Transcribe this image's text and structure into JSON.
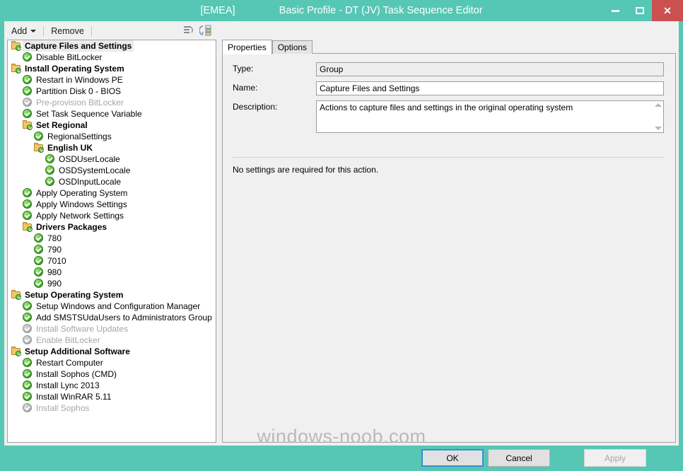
{
  "window": {
    "title_prefix": "[EMEA]",
    "title": "Basic Profile - DT (JV) Task Sequence Editor",
    "minimize_label": "Minimize",
    "maximize_label": "Maximize",
    "close_label": "Close",
    "close_glyph": "✕",
    "accent_color": "#55c7b4",
    "close_color": "#cb5050"
  },
  "toolbar": {
    "add_label": "Add",
    "remove_label": "Remove",
    "icon_rerun": "rerun-icon",
    "icon_properties": "step-properties-icon"
  },
  "tree": {
    "items": [
      {
        "label": "Capture Files and Settings",
        "indent": 0,
        "icon": "folder-check-icon",
        "type": "group",
        "state": "enabled",
        "selected": true
      },
      {
        "label": "Disable BitLocker",
        "indent": 1,
        "icon": "green-check-icon",
        "type": "step",
        "state": "enabled",
        "selected": false
      },
      {
        "label": "Install Operating System",
        "indent": 0,
        "icon": "folder-check-icon",
        "type": "group",
        "state": "enabled",
        "selected": false
      },
      {
        "label": "Restart in Windows PE",
        "indent": 1,
        "icon": "green-check-icon",
        "type": "step",
        "state": "enabled",
        "selected": false
      },
      {
        "label": "Partition Disk 0 - BIOS",
        "indent": 1,
        "icon": "green-check-icon",
        "type": "step",
        "state": "enabled",
        "selected": false
      },
      {
        "label": "Pre-provision BitLocker",
        "indent": 1,
        "icon": "grey-check-icon",
        "type": "step",
        "state": "disabled",
        "selected": false
      },
      {
        "label": "Set Task Sequence Variable",
        "indent": 1,
        "icon": "green-check-icon",
        "type": "step",
        "state": "enabled",
        "selected": false
      },
      {
        "label": "Set Regional",
        "indent": 1,
        "icon": "folder-check-icon",
        "type": "group",
        "state": "enabled",
        "selected": false
      },
      {
        "label": "RegionalSettings",
        "indent": 2,
        "icon": "green-check-icon",
        "type": "step",
        "state": "enabled",
        "selected": false
      },
      {
        "label": "English UK",
        "indent": 2,
        "icon": "folder-check-icon",
        "type": "group",
        "state": "enabled",
        "selected": false
      },
      {
        "label": "OSDUserLocale",
        "indent": 3,
        "icon": "green-check-icon",
        "type": "step",
        "state": "enabled",
        "selected": false
      },
      {
        "label": "OSDSystemLocale",
        "indent": 3,
        "icon": "green-check-icon",
        "type": "step",
        "state": "enabled",
        "selected": false
      },
      {
        "label": "OSDInputLocale",
        "indent": 3,
        "icon": "green-check-icon",
        "type": "step",
        "state": "enabled",
        "selected": false
      },
      {
        "label": "Apply Operating System",
        "indent": 1,
        "icon": "green-check-icon",
        "type": "step",
        "state": "enabled",
        "selected": false
      },
      {
        "label": "Apply Windows Settings",
        "indent": 1,
        "icon": "green-check-icon",
        "type": "step",
        "state": "enabled",
        "selected": false
      },
      {
        "label": "Apply Network Settings",
        "indent": 1,
        "icon": "green-check-icon",
        "type": "step",
        "state": "enabled",
        "selected": false
      },
      {
        "label": "Drivers Packages",
        "indent": 1,
        "icon": "folder-check-icon",
        "type": "group",
        "state": "enabled",
        "selected": false
      },
      {
        "label": "780",
        "indent": 2,
        "icon": "green-check-icon",
        "type": "step",
        "state": "enabled",
        "selected": false
      },
      {
        "label": "790",
        "indent": 2,
        "icon": "green-check-icon",
        "type": "step",
        "state": "enabled",
        "selected": false
      },
      {
        "label": "7010",
        "indent": 2,
        "icon": "green-check-icon",
        "type": "step",
        "state": "enabled",
        "selected": false
      },
      {
        "label": "980",
        "indent": 2,
        "icon": "green-check-icon",
        "type": "step",
        "state": "enabled",
        "selected": false
      },
      {
        "label": "990",
        "indent": 2,
        "icon": "green-check-icon",
        "type": "step",
        "state": "enabled",
        "selected": false
      },
      {
        "label": "Setup Operating System",
        "indent": 0,
        "icon": "folder-check-icon",
        "type": "group",
        "state": "enabled",
        "selected": false
      },
      {
        "label": "Setup Windows and Configuration Manager",
        "indent": 1,
        "icon": "green-check-icon",
        "type": "step",
        "state": "enabled",
        "selected": false
      },
      {
        "label": "Add SMSTSUdaUsers to Administrators Group",
        "indent": 1,
        "icon": "green-check-icon",
        "type": "step",
        "state": "enabled",
        "selected": false
      },
      {
        "label": "Install Software Updates",
        "indent": 1,
        "icon": "grey-check-icon",
        "type": "step",
        "state": "disabled",
        "selected": false
      },
      {
        "label": "Enable BitLocker",
        "indent": 1,
        "icon": "grey-check-icon",
        "type": "step",
        "state": "disabled",
        "selected": false
      },
      {
        "label": "Setup Additional Software",
        "indent": 0,
        "icon": "folder-check-icon",
        "type": "group",
        "state": "enabled",
        "selected": false
      },
      {
        "label": "Restart Computer",
        "indent": 1,
        "icon": "green-check-icon",
        "type": "step",
        "state": "enabled",
        "selected": false
      },
      {
        "label": "Install Sophos (CMD)",
        "indent": 1,
        "icon": "green-check-icon",
        "type": "step",
        "state": "enabled",
        "selected": false
      },
      {
        "label": "Install Lync 2013",
        "indent": 1,
        "icon": "green-check-icon",
        "type": "step",
        "state": "enabled",
        "selected": false
      },
      {
        "label": "Install WinRAR 5.11",
        "indent": 1,
        "icon": "green-check-icon",
        "type": "step",
        "state": "enabled",
        "selected": false
      },
      {
        "label": "Install Sophos",
        "indent": 1,
        "icon": "grey-check-icon",
        "type": "step",
        "state": "disabled",
        "selected": false
      }
    ]
  },
  "tabs": [
    {
      "label": "Properties",
      "active": true
    },
    {
      "label": "Options",
      "active": false
    }
  ],
  "properties": {
    "type_label": "Type:",
    "type_value": "Group",
    "name_label": "Name:",
    "name_value": "Capture Files and Settings",
    "description_label": "Description:",
    "description_value": "Actions to capture files and settings in the original operating system",
    "no_settings_text": "No settings are required  for this action."
  },
  "footer": {
    "ok_label": "OK",
    "cancel_label": "Cancel",
    "apply_label": "Apply"
  },
  "watermark": "windows-noob.com"
}
